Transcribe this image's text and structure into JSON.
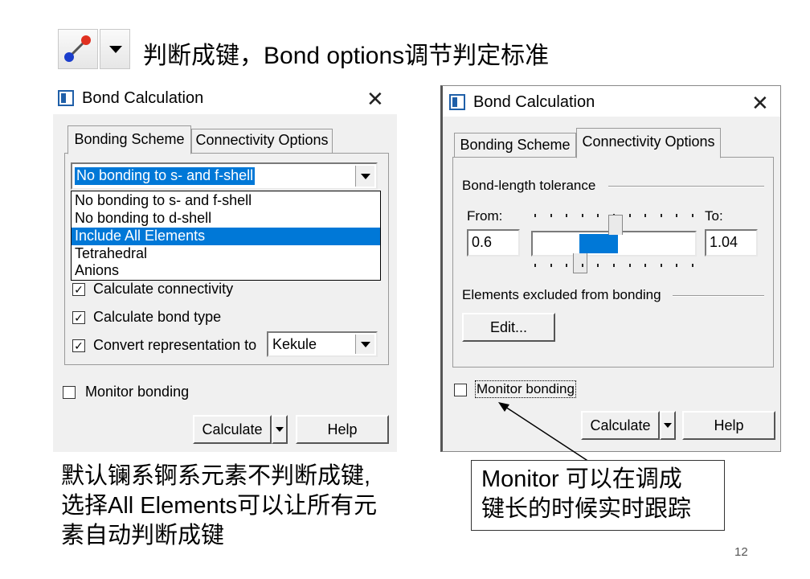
{
  "header": {
    "text": "判断成键，Bond options调节判定标准"
  },
  "left_dialog": {
    "title": "Bond Calculation",
    "tabs": [
      "Bonding Scheme",
      "Connectivity Options"
    ],
    "scheme_selected": "No bonding to s- and f-shell",
    "scheme_options": [
      "No bonding to s- and f-shell",
      "No bonding to d-shell",
      "Include All Elements",
      "Tetrahedral",
      "Anions"
    ],
    "highlighted_option": "Include All Elements",
    "checkboxes": [
      {
        "label": "Calculate connectivity",
        "checked": true
      },
      {
        "label": "Calculate bond type",
        "checked": true
      },
      {
        "label": "Convert representation to",
        "checked": true
      }
    ],
    "representation_value": "Kekule",
    "monitor_label": "Monitor bonding",
    "monitor_checked": false,
    "calculate_label": "Calculate",
    "help_label": "Help"
  },
  "right_dialog": {
    "title": "Bond Calculation",
    "tabs": [
      "Bonding Scheme",
      "Connectivity Options"
    ],
    "active_tab": "Connectivity Options",
    "tolerance_label": "Bond-length tolerance",
    "from_label": "From:",
    "from_value": "0.6",
    "to_label": "To:",
    "to_value": "1.04",
    "excluded_label": "Elements excluded from bonding",
    "edit_label": "Edit...",
    "monitor_label": "Monitor bonding",
    "monitor_checked": false,
    "calculate_label": "Calculate",
    "help_label": "Help"
  },
  "notes": {
    "left": [
      "默认镧系锕系元素不判断成键,",
      "选择All Elements可以让所有元",
      "素自动判断成键"
    ],
    "right": [
      "Monitor 可以在调成",
      "键长的时候实时跟踪"
    ]
  },
  "page_number": "12",
  "colors": {
    "selection": "#0078d7",
    "slider_fill": "#0078d7",
    "dialog_bg": "#f0f0f0"
  }
}
